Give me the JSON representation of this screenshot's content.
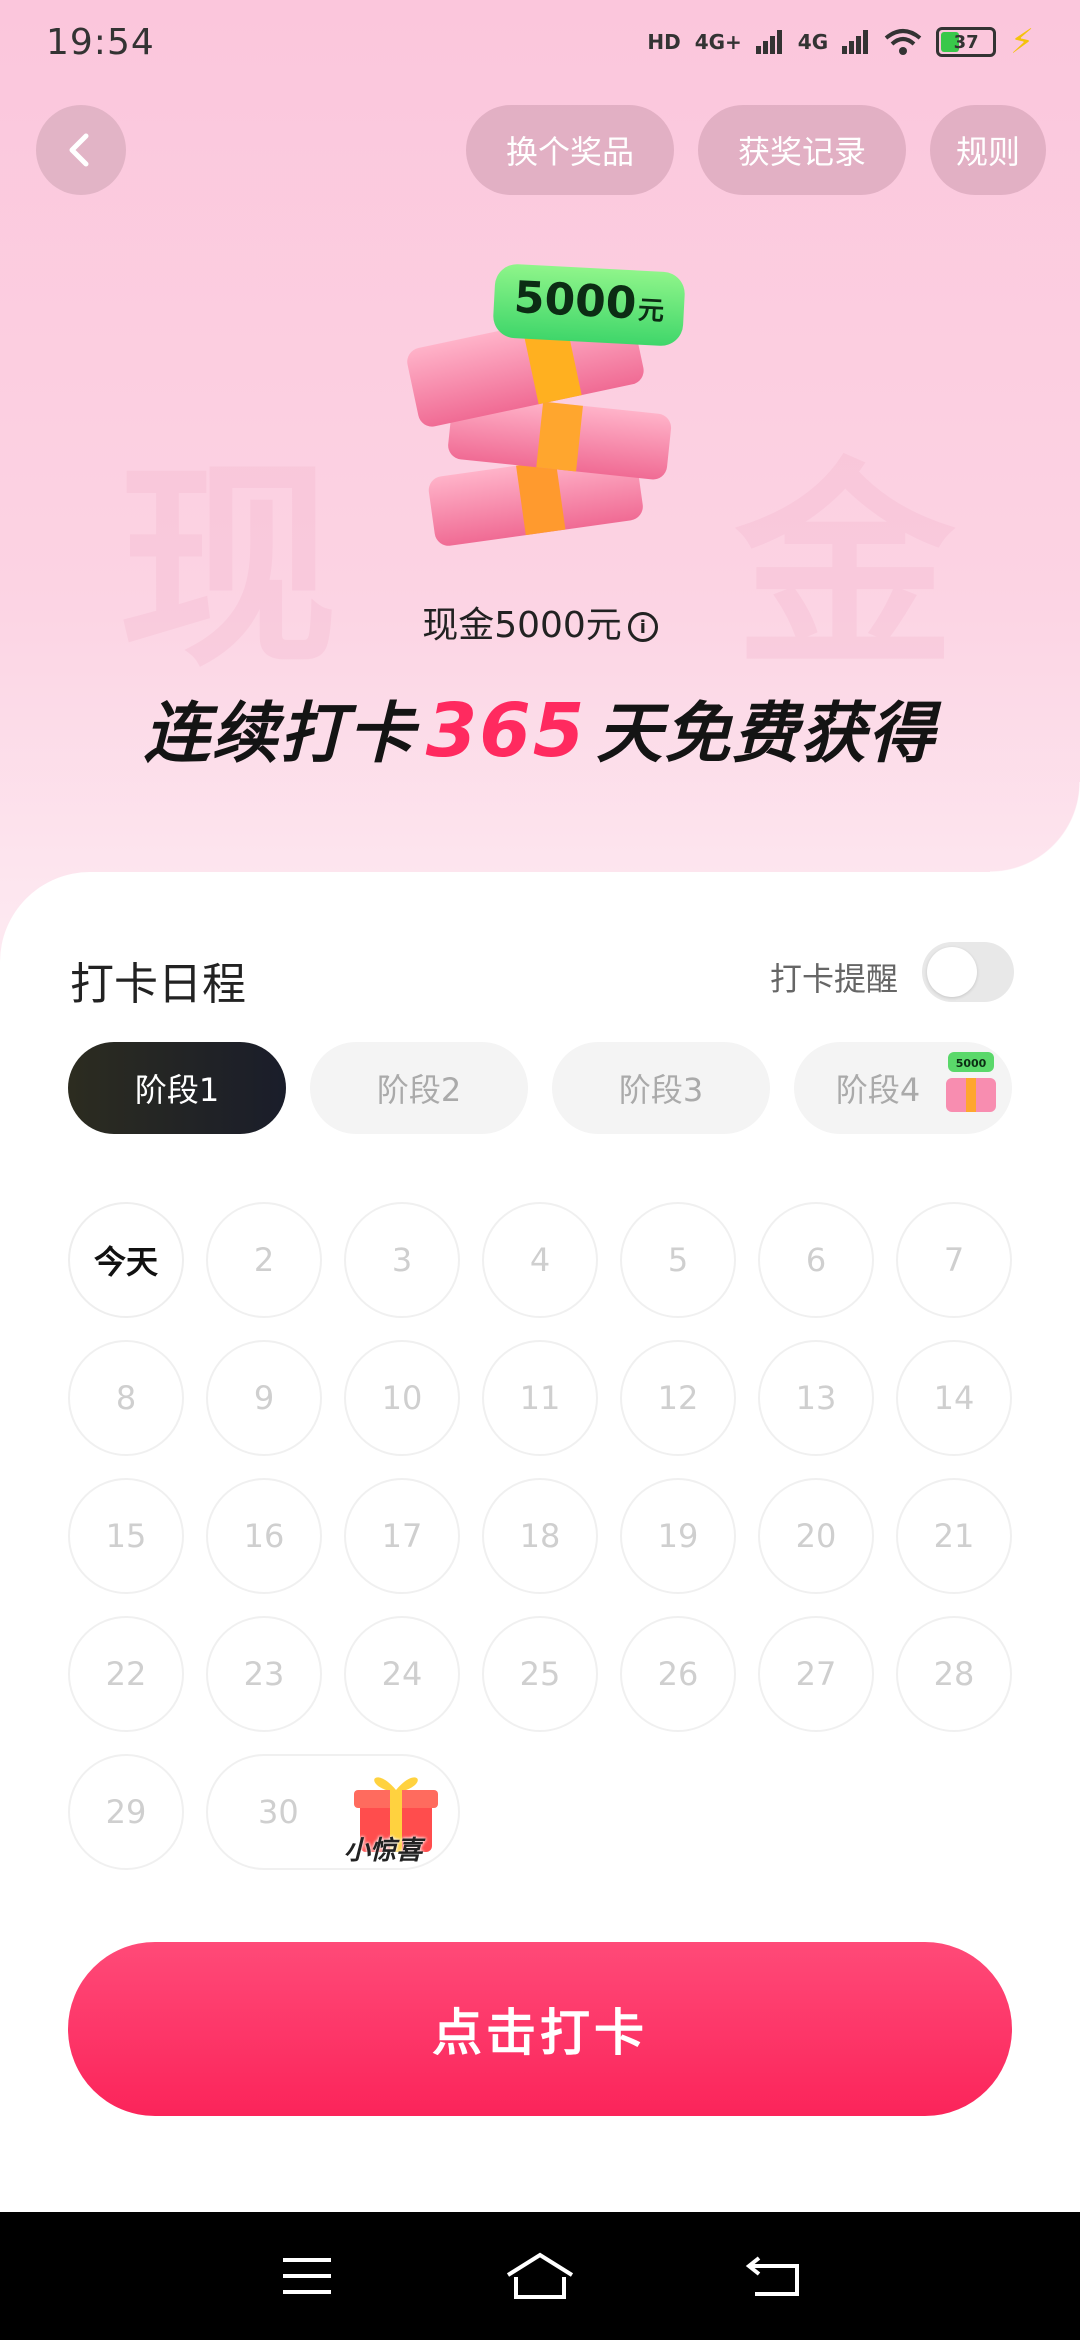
{
  "status_bar": {
    "time": "19:54",
    "hd": "HD",
    "net1": "4G+",
    "net2": "4G",
    "battery": "37"
  },
  "top_bar": {
    "change_prize": "换个奖品",
    "prize_records": "获奖记录",
    "rules": "规则"
  },
  "hero": {
    "bg_left": "现",
    "bg_right": "金",
    "tag_amount": "5000",
    "tag_unit": "元",
    "caption": "现金5000元",
    "info_glyph": "i",
    "headline_prefix": "连续打卡",
    "headline_days": "365",
    "headline_suffix": "天免费获得"
  },
  "schedule": {
    "title": "打卡日程",
    "reminder_label": "打卡提醒",
    "reminder_on": false,
    "stages": [
      "阶段1",
      "阶段2",
      "阶段3",
      "阶段4"
    ],
    "active_stage": 0,
    "stage4_gift_tag": "5000",
    "today_label": "今天",
    "days": [
      "今天",
      "2",
      "3",
      "4",
      "5",
      "6",
      "7",
      "8",
      "9",
      "10",
      "11",
      "12",
      "13",
      "14",
      "15",
      "16",
      "17",
      "18",
      "19",
      "20",
      "21",
      "22",
      "23",
      "24",
      "25",
      "26",
      "27",
      "28",
      "29",
      "30"
    ],
    "surprise_label": "小惊喜"
  },
  "action": {
    "checkin_label": "点击打卡"
  },
  "colors": {
    "accent": "#fb245a",
    "headline_number": "#ff2a5f",
    "tag_green": "#3fd66a"
  }
}
